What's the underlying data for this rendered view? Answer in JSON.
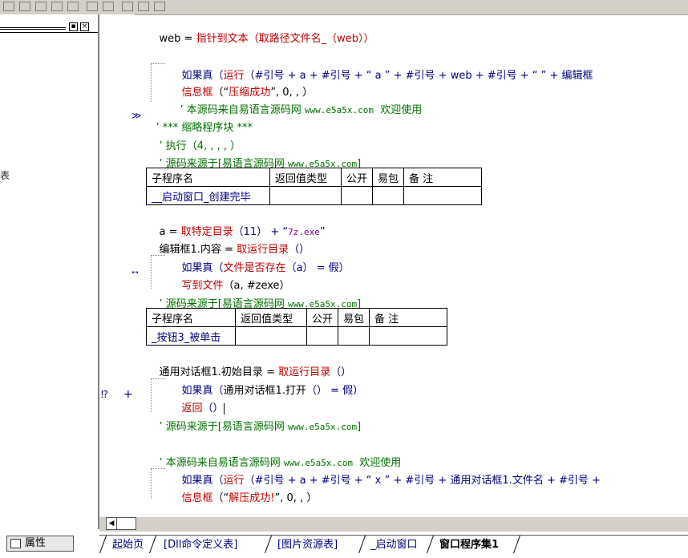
{
  "toolbar": {
    "icons": [
      "align-left-icon",
      "align-center-icon",
      "align-right-icon",
      "align-top-icon",
      "same-width-icon",
      "same-height-icon",
      "h-center-icon",
      "v-center-icon",
      "center-icon"
    ]
  },
  "left_panel": {
    "min_symbol": "▪",
    "close_symbol": "×",
    "stray_text": "表"
  },
  "props_tab": {
    "label": "属性"
  },
  "code": {
    "line1": {
      "p1": "web = ",
      "p2": "指针到文本（取路径文件名_（web））"
    },
    "line2": {
      "p1": "如果真（",
      "p2": "运行",
      "p3": "（#引号 + a + #引号 + “ a ” + #引号 + web + #引号 + “ ” + 编辑框"
    },
    "line3": {
      "p1": "信息框",
      "p2": "（“",
      "p3": "压缩成功",
      "p4": "”, 0, , ）"
    },
    "line4": {
      "p1": "’ 本源码来自易语言源码网 ",
      "p2": "www.e5a5x.com",
      "p3": "  欢迎使用"
    },
    "line5": {
      "p1": "’ *** 缩略程序块 ***"
    },
    "line6": {
      "p1": "’ 执行（4, , , , ）"
    },
    "line7": {
      "p1": "’ 源码来源于[易语言源码网 ",
      "p2": "www.e5a5x.com",
      "p3": "]"
    },
    "table1": {
      "headers": [
        "子程序名",
        "返回值类型",
        "公开",
        "易包",
        "备 注"
      ],
      "name": "__启动窗口_创建完毕"
    },
    "line8": {
      "p1": "a = ",
      "p2": "取特定目录",
      "p3": "（11） + “",
      "p4": "7z.exe",
      "p5": "”"
    },
    "line9": {
      "p1": "编辑框1.内容 = ",
      "p2": "取运行目录",
      "p3": "（）"
    },
    "line10": {
      "p1": "如果真（",
      "p2": "文件是否存在",
      "p3": "（a） = 假）"
    },
    "line11": {
      "p1": "写到文件",
      "p2": "（a, #zexe）"
    },
    "line12": {
      "p1": "’ 源码来源于[易语言源码网 ",
      "p2": "www.e5a5x.com",
      "p3": "]"
    },
    "table2": {
      "headers": [
        "子程序名",
        "返回值类型",
        "公开",
        "易包",
        "备 注"
      ],
      "name": "_按钮3_被单击"
    },
    "line13": {
      "p1": "通用对话框1.初始目录 = ",
      "p2": "取运行目录",
      "p3": "（）"
    },
    "line14": {
      "p1": "如果真（",
      "p2": "通用对话框1.打开",
      "p3": "（） = 假）"
    },
    "line15": {
      "p1": "返回",
      "p2": "（）"
    },
    "line16": {
      "p1": "’ 源码来源于[易语言源码网 ",
      "p2": "www.e5a5x.com",
      "p3": "]"
    },
    "line17": {
      "p1": "’ 本源码来自易语言源码网 ",
      "p2": "www.e5a5x.com",
      "p3": "  欢迎使用"
    },
    "line18": {
      "p1": "如果真（",
      "p2": "运行",
      "p3": "（#引号 + a + #引号 + “ x ” + #引号 + 通用对话框1.文件名 + #引号 +"
    },
    "line19": {
      "p1": "信息框",
      "p2": "（“",
      "p3": "解压成功!",
      "p4": "”, 0, , ）"
    }
  },
  "margin": {
    "collapse_mark": "≫",
    "expand_mark": "⁍⁍",
    "plus_mark": "+"
  },
  "hscroll": {
    "left_arrow": "◀"
  },
  "tabs": [
    "起始页",
    "[Dll命令定义表]",
    "[图片资源表]",
    "_启动窗口",
    "窗口程序集1"
  ],
  "colors": {
    "keyword": "#c00000",
    "comment": "#007000",
    "text": "#000080",
    "panel": "#d4d0c8"
  }
}
